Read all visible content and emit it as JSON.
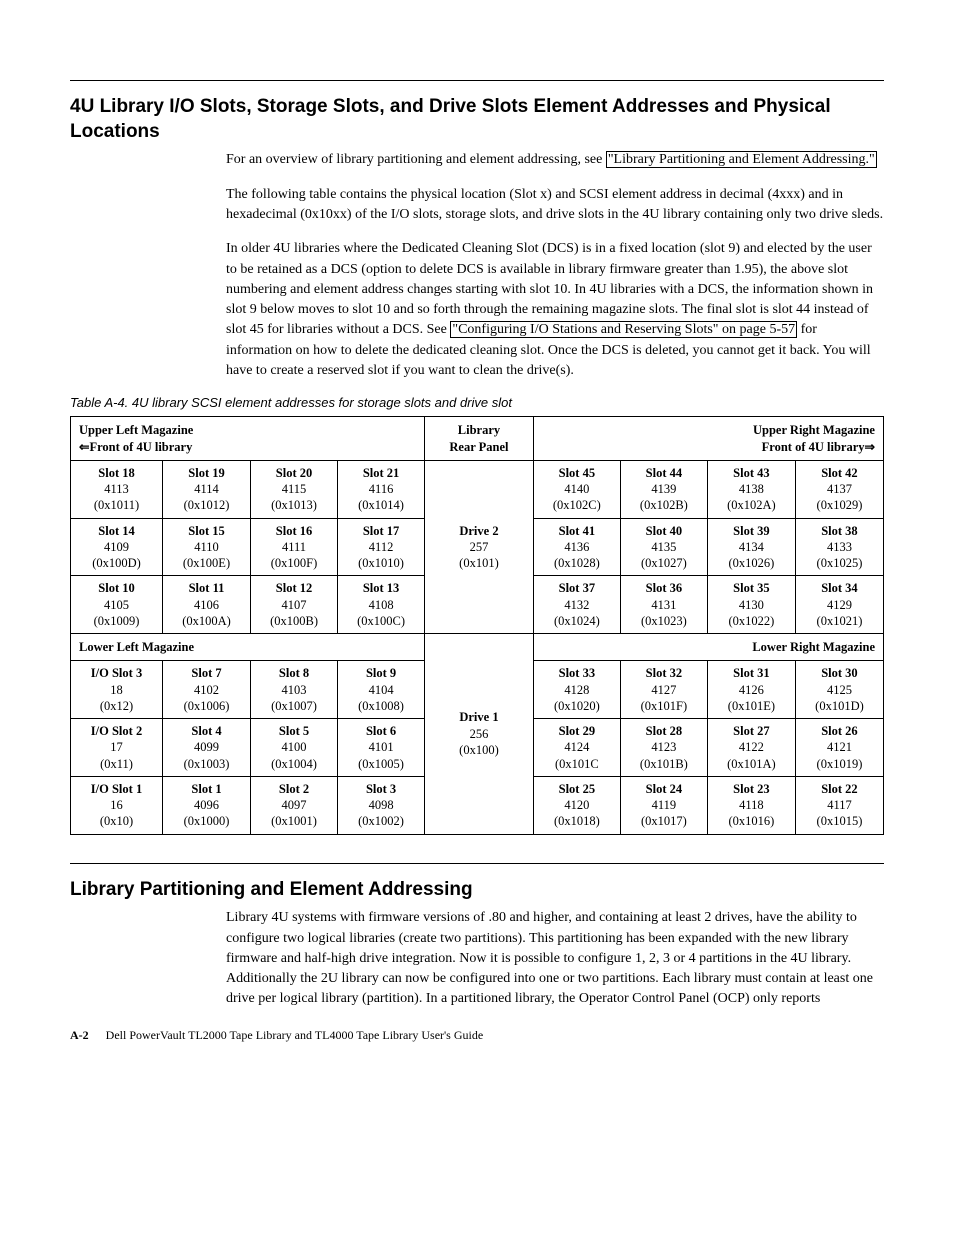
{
  "section1": {
    "title": "4U Library I/O Slots, Storage Slots, and Drive Slots Element Addresses and Physical Locations",
    "para1_a": "For an overview of library partitioning and element addressing, see ",
    "para1_link": "\"Library Partitioning and Element Addressing.\"",
    "para2": "The following table contains the physical location (Slot x) and SCSI element address in decimal (4xxx) and in hexadecimal (0x10xx) of the I/O slots, storage slots, and drive slots in the 4U library containing only two drive sleds.",
    "para3_a": "In older 4U libraries where the Dedicated Cleaning Slot (DCS) is in a fixed location (slot 9) and elected by the user to be retained as a DCS (option to delete DCS is available in library firmware greater than 1.95), the above slot numbering and element address changes starting with slot 10. In 4U libraries with a DCS, the information shown in slot 9 below moves to slot 10 and so forth through the remaining magazine slots. The final slot is slot 44 instead of slot 45 for libraries without a DCS. See ",
    "para3_link": "\"Configuring I/O Stations and Reserving Slots\" on page 5-57",
    "para3_b": " for information on how to delete the dedicated cleaning slot. Once the DCS is deleted, you cannot get it back. You will have to create a reserved slot if you want to clean the drive(s)."
  },
  "table": {
    "caption": "Table A-4. 4U library SCSI element addresses for storage slots and drive slot",
    "hdr_ul_line1": "Upper Left Magazine",
    "hdr_ul_line2": "⇐Front of 4U library",
    "hdr_lib_line1": "Library",
    "hdr_lib_line2": "Rear Panel",
    "hdr_ur_line1": "Upper Right Magazine",
    "hdr_ur_line2": "Front of 4U library⇒",
    "hdr_ll": "Lower Left Magazine",
    "hdr_lr": "Lower Right Magazine",
    "drive2": {
      "name": "Drive 2",
      "dec": "257",
      "hex": "(0x101)"
    },
    "drive1": {
      "name": "Drive 1",
      "dec": "256",
      "hex": "(0x100)"
    },
    "ul": [
      [
        {
          "n": "Slot 18",
          "d": "4113",
          "h": "(0x1011)"
        },
        {
          "n": "Slot 19",
          "d": "4114",
          "h": "(0x1012)"
        },
        {
          "n": "Slot 20",
          "d": "4115",
          "h": "(0x1013)"
        },
        {
          "n": "Slot 21",
          "d": "4116",
          "h": "(0x1014)"
        }
      ],
      [
        {
          "n": "Slot 14",
          "d": "4109",
          "h": "(0x100D)"
        },
        {
          "n": "Slot 15",
          "d": "4110",
          "h": "(0x100E)"
        },
        {
          "n": "Slot 16",
          "d": "4111",
          "h": "(0x100F)"
        },
        {
          "n": "Slot 17",
          "d": "4112",
          "h": "(0x1010)"
        }
      ],
      [
        {
          "n": "Slot 10",
          "d": "4105",
          "h": "(0x1009)"
        },
        {
          "n": "Slot 11",
          "d": "4106",
          "h": "(0x100A)"
        },
        {
          "n": "Slot 12",
          "d": "4107",
          "h": "(0x100B)"
        },
        {
          "n": "Slot 13",
          "d": "4108",
          "h": "(0x100C)"
        }
      ]
    ],
    "ur": [
      [
        {
          "n": "Slot 45",
          "d": "4140",
          "h": "(0x102C)"
        },
        {
          "n": "Slot 44",
          "d": "4139",
          "h": "(0x102B)"
        },
        {
          "n": "Slot 43",
          "d": "4138",
          "h": "(0x102A)"
        },
        {
          "n": "Slot 42",
          "d": "4137",
          "h": "(0x1029)"
        }
      ],
      [
        {
          "n": "Slot 41",
          "d": "4136",
          "h": "(0x1028)"
        },
        {
          "n": "Slot 40",
          "d": "4135",
          "h": "(0x1027)"
        },
        {
          "n": "Slot 39",
          "d": "4134",
          "h": "(0x1026)"
        },
        {
          "n": "Slot 38",
          "d": "4133",
          "h": "(0x1025)"
        }
      ],
      [
        {
          "n": "Slot 37",
          "d": "4132",
          "h": "(0x1024)"
        },
        {
          "n": "Slot 36",
          "d": "4131",
          "h": "(0x1023)"
        },
        {
          "n": "Slot 35",
          "d": "4130",
          "h": "(0x1022)"
        },
        {
          "n": "Slot 34",
          "d": "4129",
          "h": "(0x1021)"
        }
      ]
    ],
    "ll": [
      [
        {
          "n": "I/O Slot 3",
          "d": "18",
          "h": "(0x12)"
        },
        {
          "n": "Slot 7",
          "d": "4102",
          "h": "(0x1006)"
        },
        {
          "n": "Slot 8",
          "d": "4103",
          "h": "(0x1007)"
        },
        {
          "n": "Slot 9",
          "d": "4104",
          "h": "(0x1008)"
        }
      ],
      [
        {
          "n": "I/O Slot 2",
          "d": "17",
          "h": "(0x11)"
        },
        {
          "n": "Slot 4",
          "d": "4099",
          "h": "(0x1003)"
        },
        {
          "n": "Slot 5",
          "d": "4100",
          "h": "(0x1004)"
        },
        {
          "n": "Slot 6",
          "d": "4101",
          "h": "(0x1005)"
        }
      ],
      [
        {
          "n": "I/O Slot 1",
          "d": "16",
          "h": "(0x10)"
        },
        {
          "n": "Slot 1",
          "d": "4096",
          "h": "(0x1000)"
        },
        {
          "n": "Slot 2",
          "d": "4097",
          "h": "(0x1001)"
        },
        {
          "n": "Slot 3",
          "d": "4098",
          "h": "(0x1002)"
        }
      ]
    ],
    "lr": [
      [
        {
          "n": "Slot 33",
          "d": "4128",
          "h": "(0x1020)"
        },
        {
          "n": "Slot 32",
          "d": "4127",
          "h": "(0x101F)"
        },
        {
          "n": "Slot 31",
          "d": "4126",
          "h": "(0x101E)"
        },
        {
          "n": "Slot 30",
          "d": "4125",
          "h": "(0x101D)"
        }
      ],
      [
        {
          "n": "Slot 29",
          "d": "4124",
          "h": "(0x101C"
        },
        {
          "n": "Slot 28",
          "d": "4123",
          "h": "(0x101B)"
        },
        {
          "n": "Slot 27",
          "d": "4122",
          "h": "(0x101A)"
        },
        {
          "n": "Slot 26",
          "d": "4121",
          "h": "(0x1019)"
        }
      ],
      [
        {
          "n": "Slot 25",
          "d": "4120",
          "h": "(0x1018)"
        },
        {
          "n": "Slot 24",
          "d": "4119",
          "h": "(0x1017)"
        },
        {
          "n": "Slot 23",
          "d": "4118",
          "h": "(0x1016)"
        },
        {
          "n": "Slot 22",
          "d": "4117",
          "h": "(0x1015)"
        }
      ]
    ]
  },
  "section2": {
    "title": "Library Partitioning and Element Addressing",
    "para1": "Library 4U systems with firmware versions of .80 and higher, and containing at least 2 drives, have the ability to configure two logical libraries (create two partitions). This partitioning has been expanded with the new library firmware and half-high drive integration. Now it is possible to configure 1, 2, 3 or 4 partitions in the 4U library. Additionally the 2U library can now be configured into one or two partitions. Each library must contain at least one drive per logical library (partition). In a partitioned library, the Operator Control Panel (OCP) only reports"
  },
  "footer": {
    "pageno": "A-2",
    "booktitle": "Dell PowerVault TL2000 Tape Library and TL4000 Tape Library User's Guide"
  }
}
